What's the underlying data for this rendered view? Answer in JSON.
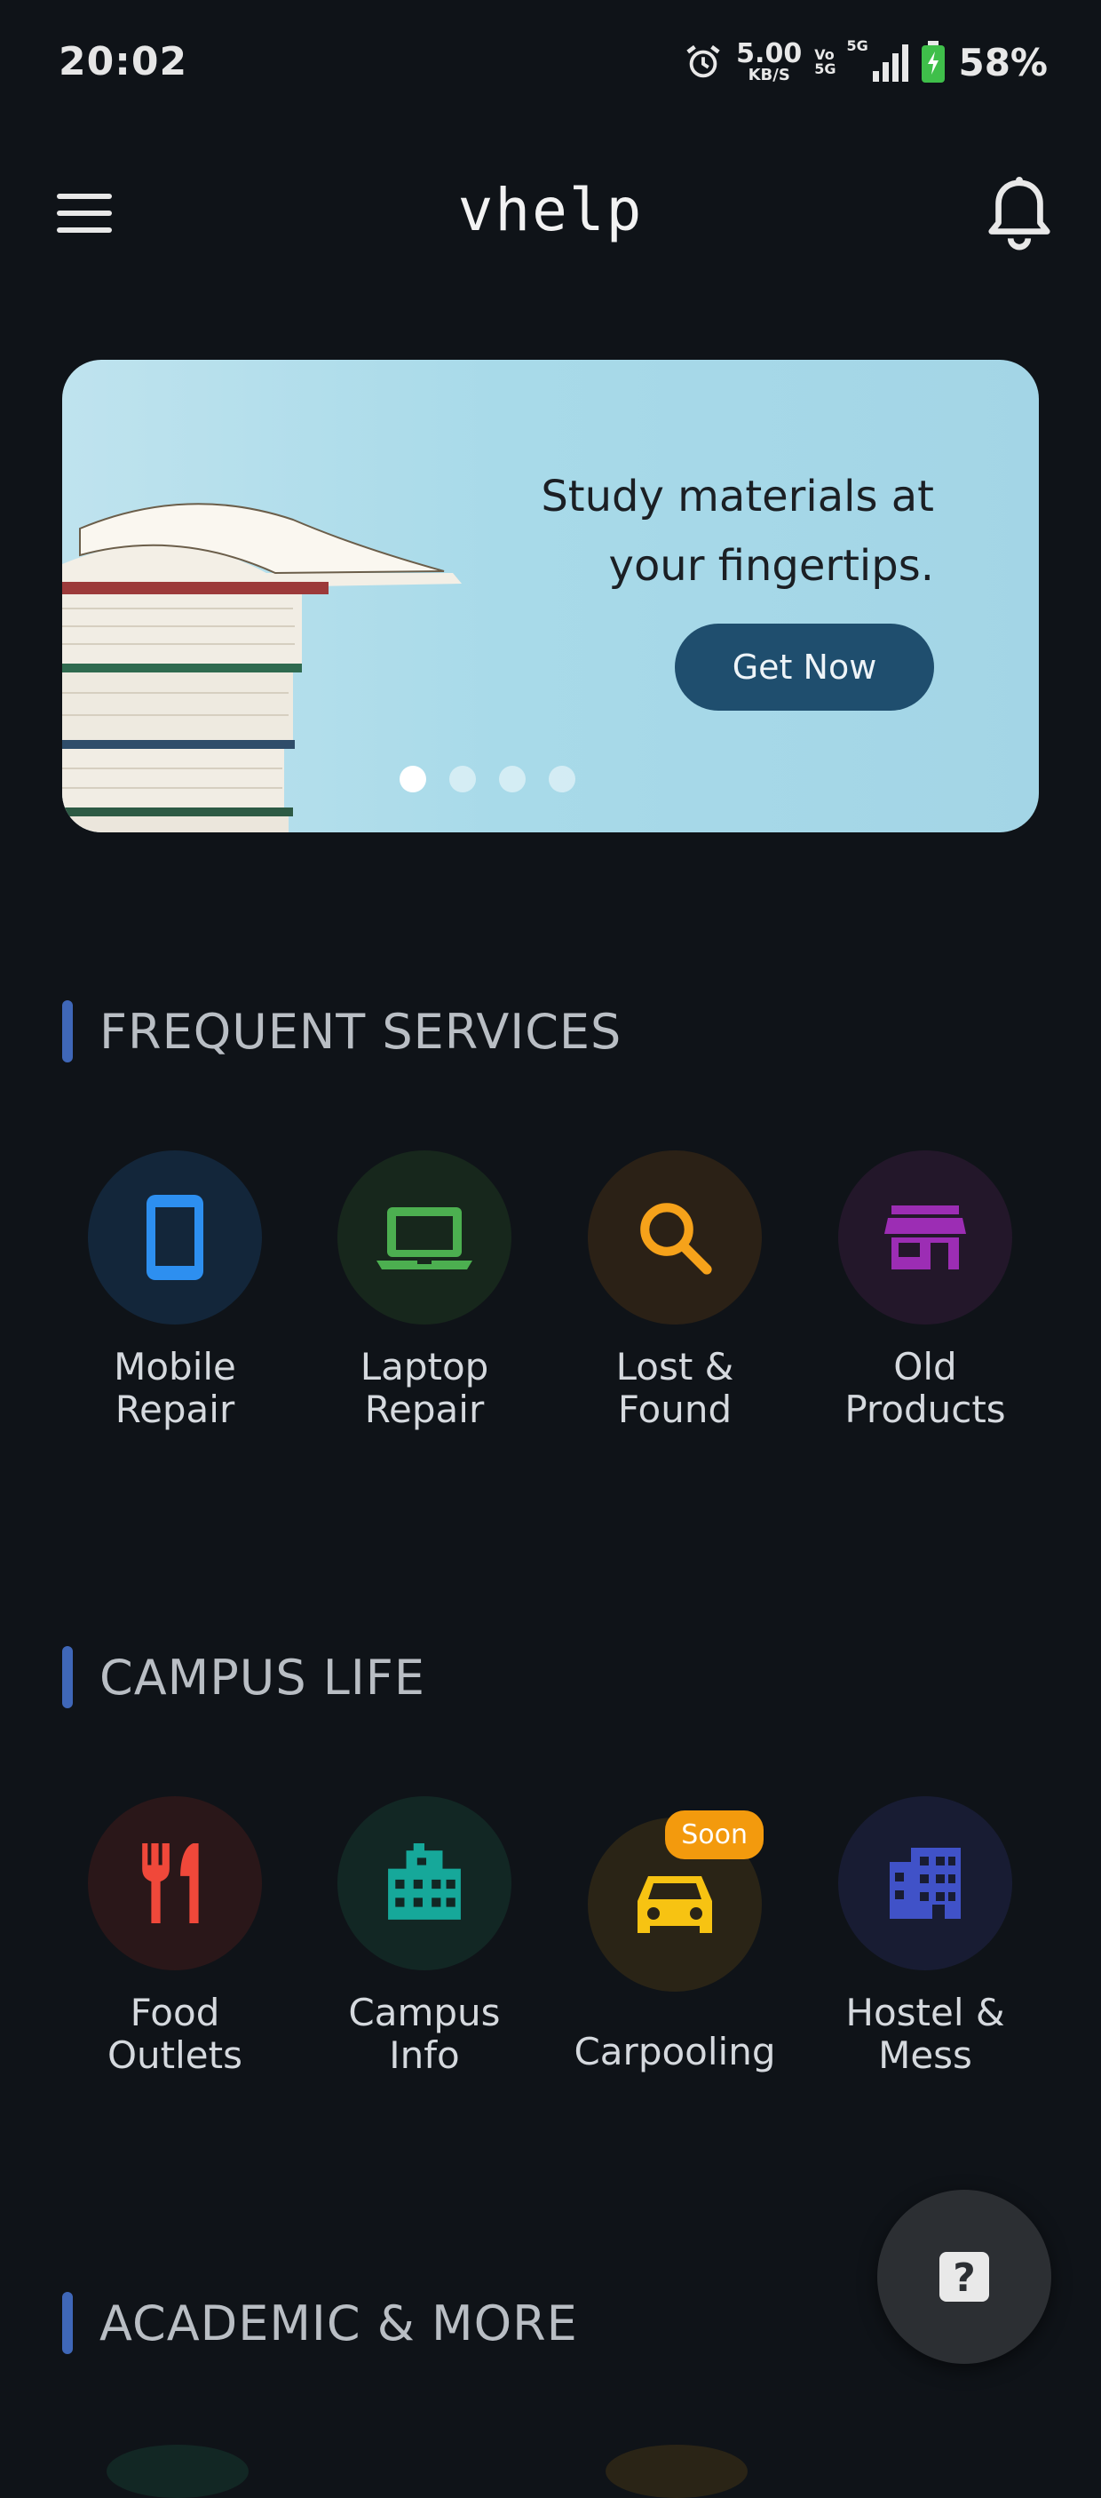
{
  "status_bar": {
    "time": "20:02",
    "net_speed_value": "5.00",
    "net_speed_unit": "KB/S",
    "volte_top": "Vo",
    "volte_bottom": "5G",
    "network_type": "5G",
    "battery_percent": "58%"
  },
  "app_bar": {
    "title": "vhelp",
    "menu_icon": "hamburger-menu-icon",
    "notification_icon": "bell-icon"
  },
  "banner": {
    "line1": "Study materials at",
    "line2": "your fingertips.",
    "button_label": "Get Now",
    "slide_count": 4,
    "active_slide": 1
  },
  "sections": {
    "frequent": {
      "title": "FREQUENT SERVICES",
      "items": [
        {
          "line1": "Mobile",
          "line2": "Repair",
          "icon": "smartphone-icon",
          "color": "#2d8ff0",
          "bg": "#13263a"
        },
        {
          "line1": "Laptop",
          "line2": "Repair",
          "icon": "laptop-icon",
          "color": "#4caf50",
          "bg": "#17271c"
        },
        {
          "line1": "Lost &",
          "line2": "Found",
          "icon": "search-icon",
          "color": "#f6a21a",
          "bg": "#2b2116"
        },
        {
          "line1": "Old",
          "line2": "Products",
          "icon": "storefront-icon",
          "color": "#9c2db4",
          "bg": "#23172a"
        }
      ]
    },
    "campus": {
      "title": "CAMPUS LIFE",
      "items": [
        {
          "line1": "Food",
          "line2": "Outlets",
          "icon": "fork-knife-icon",
          "color": "#f0483a",
          "bg": "#2a1719"
        },
        {
          "line1": "Campus",
          "line2": "Info",
          "icon": "buildings-icon",
          "color": "#16a89a",
          "bg": "#122724"
        },
        {
          "line1": "Carpooling",
          "line2": "",
          "icon": "car-icon",
          "color": "#f7c312",
          "bg": "#2a2416",
          "badge": "Soon"
        },
        {
          "line1": "Hostel &",
          "line2": "Mess",
          "icon": "apartment-icon",
          "color": "#4052c8",
          "bg": "#181c33"
        }
      ]
    },
    "academic": {
      "title": "ACADEMIC & MORE"
    }
  },
  "fab": {
    "icon": "help-question-icon",
    "glyph": "?"
  }
}
